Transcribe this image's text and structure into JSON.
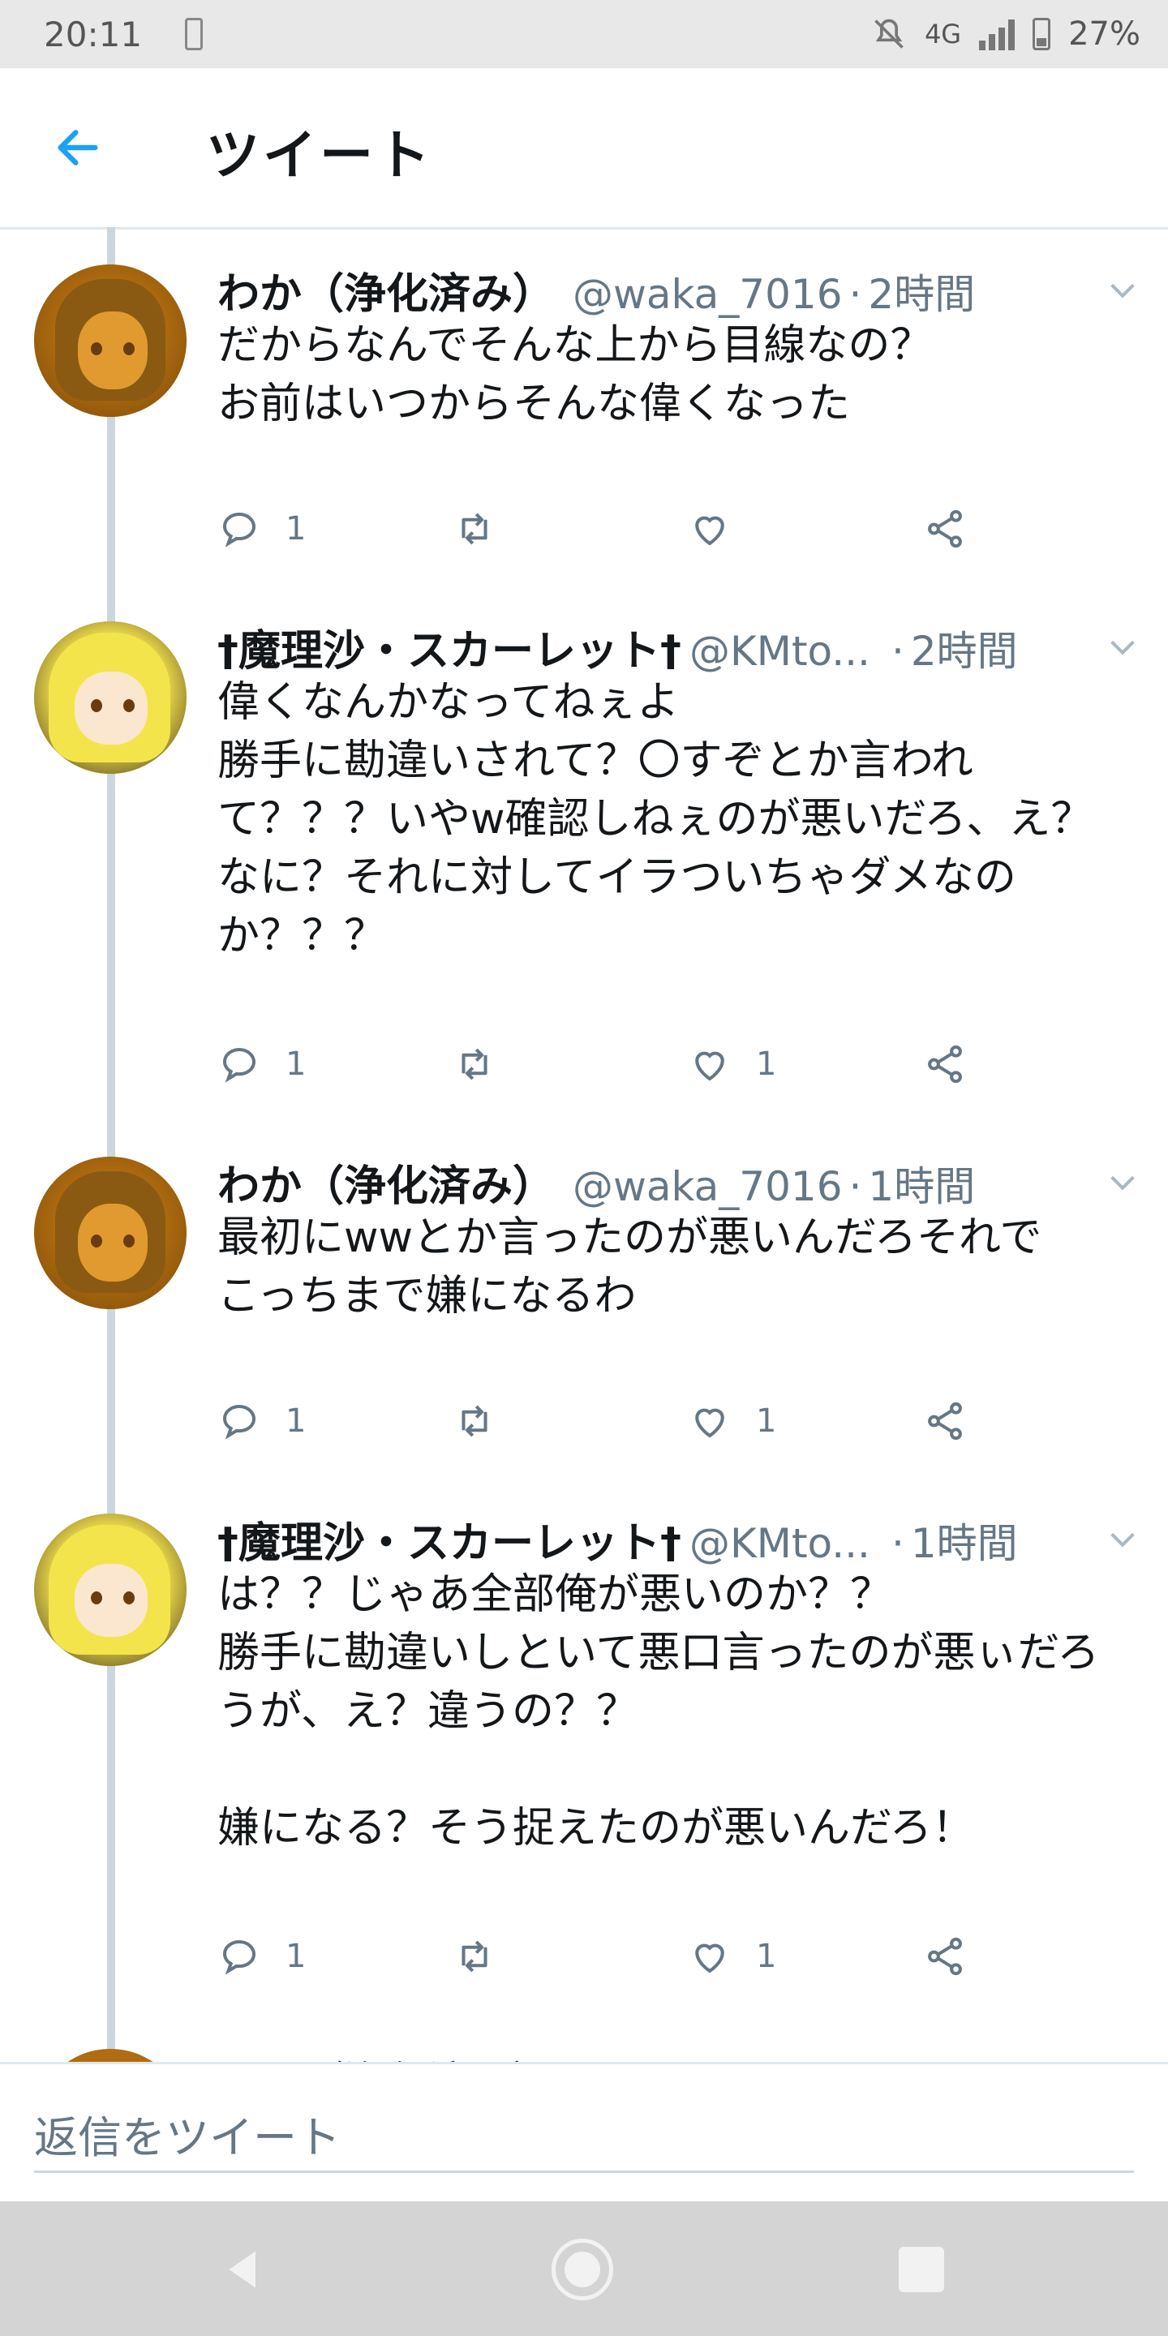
{
  "status_bar": {
    "time": "20:11",
    "network": "4G",
    "battery": "27%",
    "icons": [
      "battery-charging-icon",
      "mute-bell-icon",
      "signal-icon",
      "battery-icon"
    ]
  },
  "header": {
    "title": "ツイート",
    "back_icon": "arrow-left-icon"
  },
  "tweets": [
    {
      "name": "わか（浄化済み）",
      "handle": "@waka_7016",
      "time": "2時間",
      "body": "だからなんでそんな上から目線なの？\nお前はいつからそんな偉くなった",
      "replies": "1",
      "retweets": "",
      "likes": ""
    },
    {
      "name": "†魔理沙・スカーレット†",
      "handle": "@KMto...",
      "time": "2時間",
      "body": "偉くなんかなってねぇよ\n勝手に勘違いされて？〇すぞとか言われて？？？いやw確認しねぇのが悪いだろ、え？なに？それに対してイラついちゃダメなのか？？？",
      "replies": "1",
      "retweets": "",
      "likes": "1"
    },
    {
      "name": "わか（浄化済み）",
      "handle": "@waka_7016",
      "time": "1時間",
      "body": "最初にwwとか言ったのが悪いんだろそれで\nこっちまで嫌になるわ",
      "replies": "1",
      "retweets": "",
      "likes": "1"
    },
    {
      "name": "†魔理沙・スカーレット†",
      "handle": "@KMto...",
      "time": "1時間",
      "body": "は？？じゃあ全部俺が悪いのか？？\n勝手に勘違いしといて悪口言ったのが悪ぃだろうが、え？違うの？？\n\n嫌になる？そう捉えたのが悪いんだろ！",
      "replies": "1",
      "retweets": "",
      "likes": "1"
    }
  ],
  "peek_tweet": {
    "text": "わか（浄化済み）"
  },
  "reply_bar": {
    "placeholder": "返信をツイート"
  },
  "colors": {
    "accent": "#1da1f2",
    "text_secondary": "#657786",
    "thread_line": "#ccd6dd"
  }
}
